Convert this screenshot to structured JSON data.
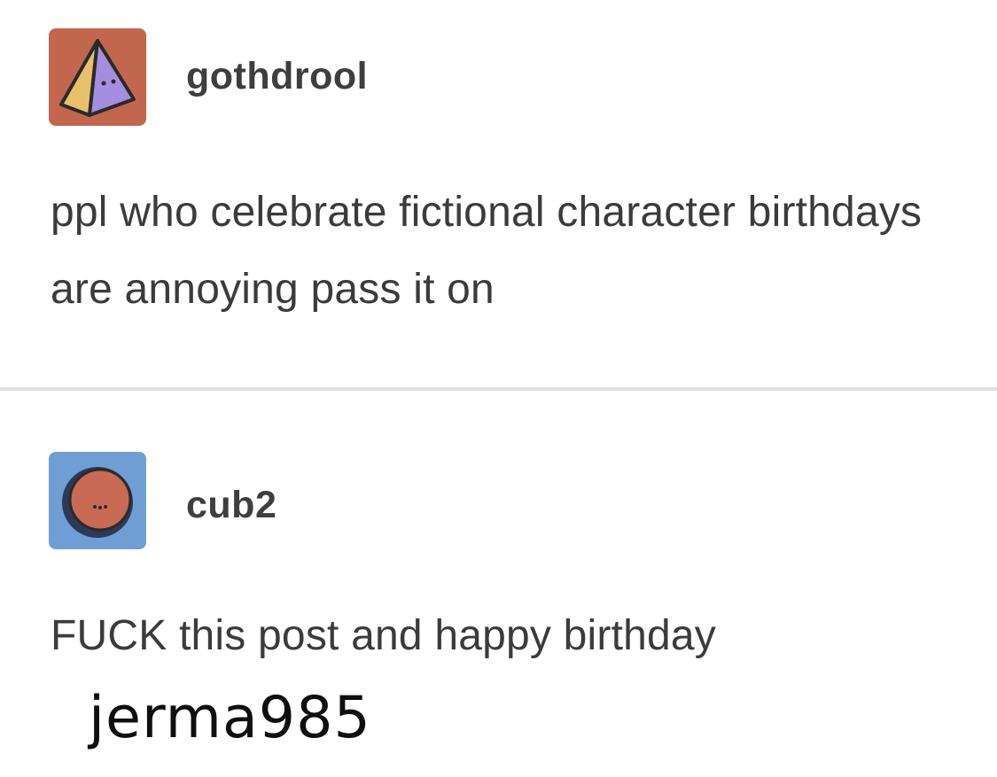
{
  "posts": [
    {
      "username": "gothdrool",
      "avatar_icon": "pyramid-face-icon",
      "text": "ppl who celebrate fictional character birthdays are annoying pass it on"
    },
    {
      "username": "cub2",
      "avatar_icon": "round-face-icon",
      "text": "FUCK this post and happy birthday"
    }
  ],
  "caption": "jerma985",
  "colors": {
    "avatar_1_bg": "#c2674e",
    "avatar_2_bg": "#6e9ed4",
    "text": "#3b3b3b",
    "divider": "#e1e1e1"
  }
}
